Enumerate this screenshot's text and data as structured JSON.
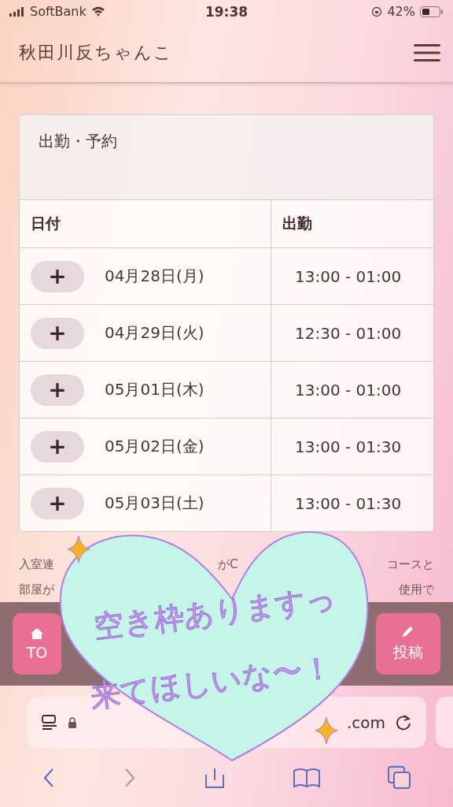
{
  "status_bar": {
    "carrier": "SoftBank",
    "time": "19:38",
    "battery": "42%"
  },
  "header": {
    "title": "秋田川反ちゃんこ"
  },
  "card": {
    "title": "出勤・予約",
    "columns": [
      "日付",
      "出勤"
    ],
    "rows": [
      {
        "button": "+",
        "date": "04月28日(月)",
        "time": "13:00 - 01:00"
      },
      {
        "button": "+",
        "date": "04月29日(火)",
        "time": "12:30 - 01:00"
      },
      {
        "button": "+",
        "date": "05月01日(木)",
        "time": "13:00 - 01:00"
      },
      {
        "button": "+",
        "date": "05月02日(金)",
        "time": "13:00 - 01:30"
      },
      {
        "button": "+",
        "date": "05月03日(土)",
        "time": "13:00 - 01:30"
      }
    ]
  },
  "notice": [
    [
      "入室連",
      "がC",
      "コースと"
    ],
    [
      "部屋が",
      "使用で"
    ]
  ],
  "bottom_buttons": [
    "TO",
    "投稿"
  ],
  "url_bar": {
    "url": ".com"
  },
  "sticker": {
    "lines": [
      "空き枠ありますっ",
      "来てほしいな〜！"
    ]
  }
}
